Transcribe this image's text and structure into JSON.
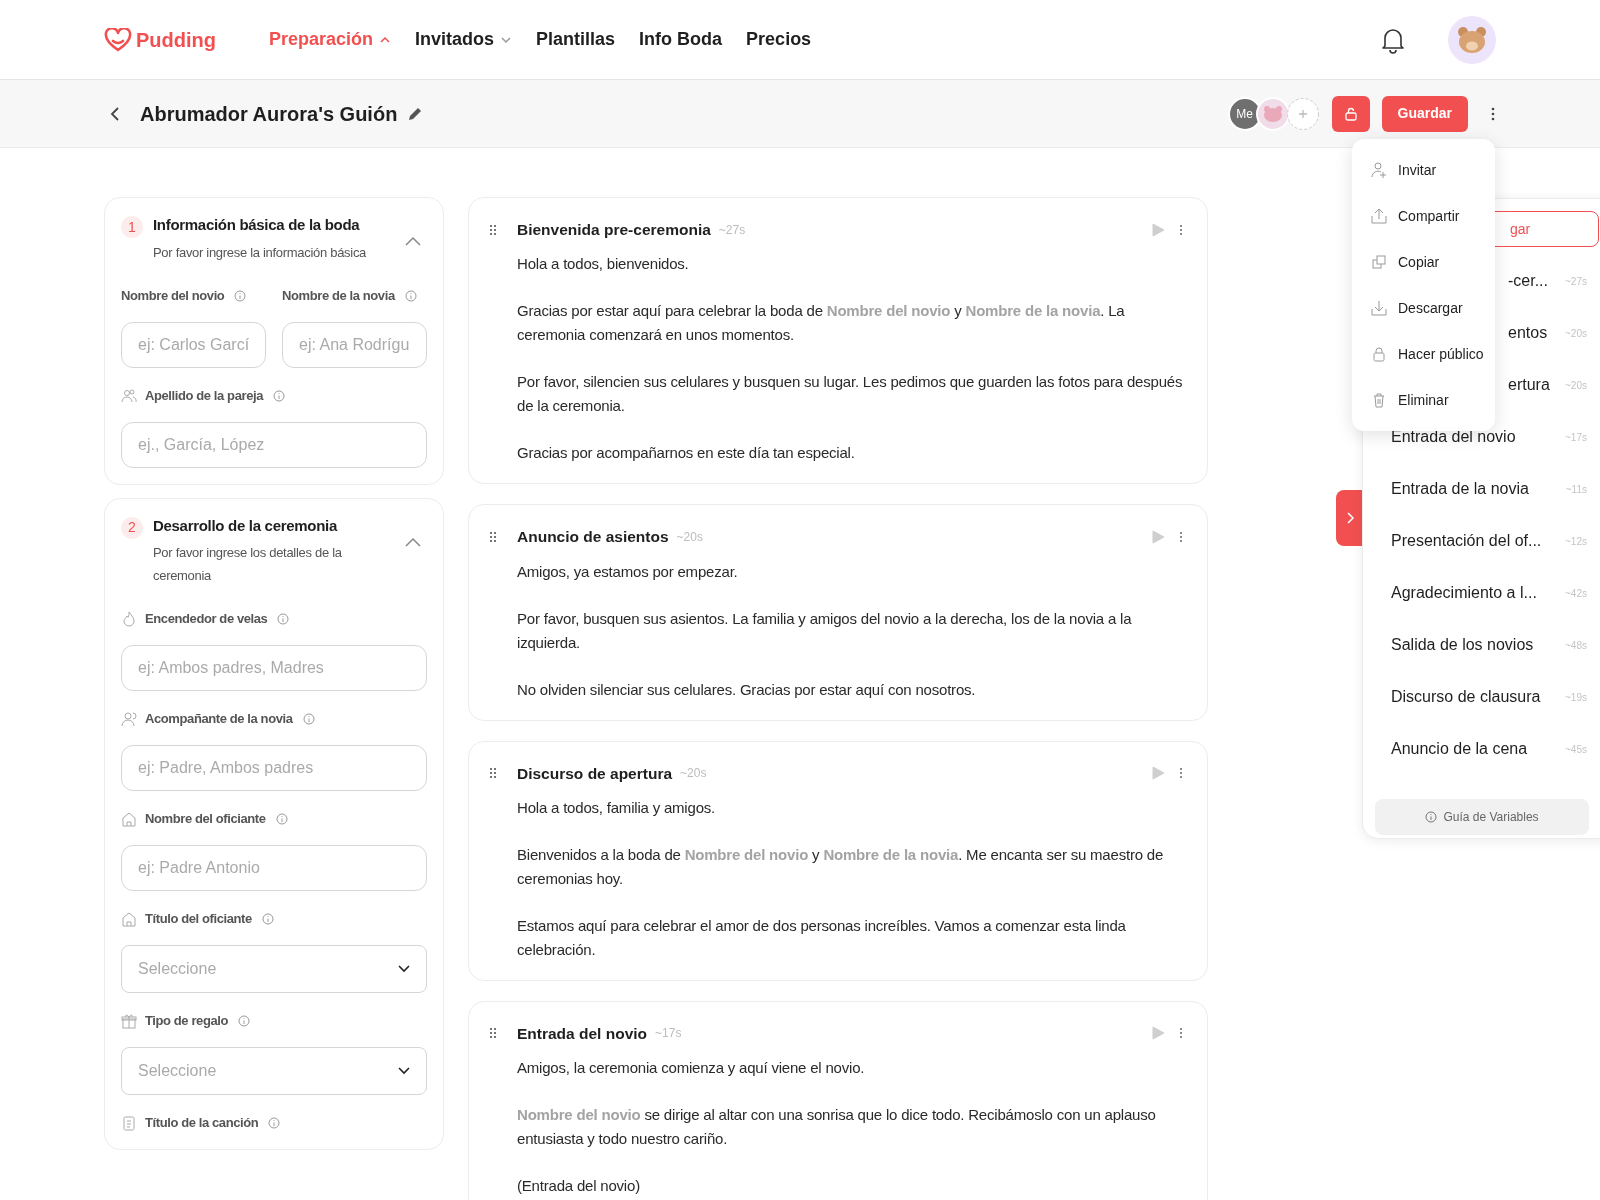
{
  "nav": {
    "logo": "Pudding",
    "items": [
      {
        "label": "Preparación",
        "selected": true,
        "has_menu": true
      },
      {
        "label": "Invitados",
        "selected": false,
        "has_menu": true
      },
      {
        "label": "Plantillas",
        "selected": false,
        "has_menu": false
      },
      {
        "label": "Info Boda",
        "selected": false,
        "has_menu": false
      },
      {
        "label": "Precios",
        "selected": false,
        "has_menu": false
      }
    ]
  },
  "toolbar": {
    "title": "Abrumador Aurora's Guión",
    "me_avatar": "Me",
    "save": "Guardar"
  },
  "sections": [
    {
      "number": "1",
      "title": "Información básica de la boda",
      "subtitle": "Por favor ingrese la información básica",
      "expanded": true,
      "fields": [
        {
          "label": "Nombre del novio",
          "placeholder": "ej: Carlos Garcí",
          "kind": "half"
        },
        {
          "label": "Nombre de la novia",
          "placeholder": "ej: Ana Rodrígu",
          "kind": "half"
        },
        {
          "label": "Apellido de la pareja",
          "placeholder": "ej., García, López",
          "kind": "input"
        }
      ]
    },
    {
      "number": "2",
      "title": "Desarrollo de la ceremonia",
      "subtitle": "Por favor ingrese los detalles de la ceremonia",
      "expanded": true,
      "fields": [
        {
          "label": "Encendedor de velas",
          "placeholder": "ej: Ambos padres, Madres",
          "kind": "input"
        },
        {
          "label": "Acompañante de la novia",
          "placeholder": "ej: Padre, Ambos padres",
          "kind": "input"
        },
        {
          "label": "Nombre del oficiante",
          "placeholder": "ej: Padre Antonio",
          "kind": "input"
        },
        {
          "label": "Título del oficiante",
          "placeholder": "Seleccione",
          "kind": "select"
        },
        {
          "label": "Tipo de regalo",
          "placeholder": "Seleccione",
          "kind": "select"
        },
        {
          "label": "Título de la canción",
          "kind": "label"
        }
      ]
    }
  ],
  "script": [
    {
      "title": "Bienvenida pre-ceremonia",
      "duration": "~27s",
      "paragraphs": [
        [
          {
            "kind": "text",
            "text": "Hola a todos, bienvenidos."
          }
        ],
        [
          {
            "kind": "text",
            "text": "Gracias por estar aquí para celebrar la boda de "
          },
          {
            "kind": "variable",
            "text": "Nombre del novio"
          },
          {
            "kind": "text",
            "text": " y "
          },
          {
            "kind": "variable",
            "text": "Nombre de la novia"
          },
          {
            "kind": "text",
            "text": ". La ceremonia comenzará en unos momentos."
          }
        ],
        [
          {
            "kind": "text",
            "text": "Por favor, silencien sus celulares y busquen su lugar. Les pedimos que guarden las fotos para después de la ceremonia."
          }
        ],
        [
          {
            "kind": "text",
            "text": "Gracias por acompañarnos en este día tan especial."
          }
        ]
      ]
    },
    {
      "title": "Anuncio de asientos",
      "duration": "~20s",
      "paragraphs": [
        [
          {
            "kind": "text",
            "text": "Amigos, ya estamos por empezar."
          }
        ],
        [
          {
            "kind": "text",
            "text": "Por favor, busquen sus asientos. La familia y amigos del novio a la derecha, los de la novia a la izquierda."
          }
        ],
        [
          {
            "kind": "text",
            "text": "No olviden silenciar sus celulares. Gracias por estar aquí con nosotros."
          }
        ]
      ]
    },
    {
      "title": "Discurso de apertura",
      "duration": "~20s",
      "paragraphs": [
        [
          {
            "kind": "text",
            "text": "Hola a todos, familia y amigos."
          }
        ],
        [
          {
            "kind": "text",
            "text": "Bienvenidos a la boda de "
          },
          {
            "kind": "variable",
            "text": "Nombre del novio"
          },
          {
            "kind": "text",
            "text": " y "
          },
          {
            "kind": "variable",
            "text": "Nombre de la novia"
          },
          {
            "kind": "text",
            "text": ". Me encanta ser su maestro de ceremonias hoy."
          }
        ],
        [
          {
            "kind": "text",
            "text": "Estamos aquí para celebrar el amor de dos personas increíbles. Vamos a comenzar esta linda celebración."
          }
        ]
      ]
    },
    {
      "title": "Entrada del novio",
      "duration": "~17s",
      "paragraphs": [
        [
          {
            "kind": "text",
            "text": "Amigos, la ceremonia comienza y aquí viene el novio."
          }
        ],
        [
          {
            "kind": "variable",
            "text": "Nombre del novio"
          },
          {
            "kind": "text",
            "text": " se dirige al altar con una sonrisa que lo dice todo. Recibámoslo con un aplauso entusiasta y todo nuestro cariño."
          }
        ],
        [
          {
            "kind": "text",
            "text": "(Entrada del novio)"
          }
        ]
      ]
    }
  ],
  "outline": {
    "add_button": "gar",
    "items": [
      {
        "title": "-cer...",
        "duration": "~27s",
        "covered": true
      },
      {
        "title": "entos",
        "duration": "~20s",
        "covered": true
      },
      {
        "title": "ertura",
        "duration": "~20s",
        "covered": true
      },
      {
        "title": "Entrada del novio",
        "duration": "~17s",
        "covered": false
      },
      {
        "title": "Entrada de la novia",
        "duration": "~11s",
        "covered": false
      },
      {
        "title": "Presentación del of...",
        "duration": "~12s",
        "covered": false
      },
      {
        "title": "Agradecimiento a l...",
        "duration": "~42s",
        "covered": false
      },
      {
        "title": "Salida de los novios",
        "duration": "~48s",
        "covered": false
      },
      {
        "title": "Discurso de clausura",
        "duration": "~19s",
        "covered": false
      },
      {
        "title": "Anuncio de la cena",
        "duration": "~45s",
        "covered": false
      }
    ],
    "guide": "Guía de Variables"
  },
  "menu": [
    {
      "label": "Invitar"
    },
    {
      "label": "Compartir"
    },
    {
      "label": "Copiar"
    },
    {
      "label": "Descargar"
    },
    {
      "label": "Hacer público"
    },
    {
      "label": "Eliminar"
    }
  ]
}
